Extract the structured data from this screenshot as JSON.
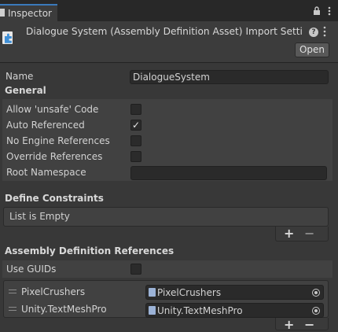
{
  "tab": {
    "label": "Inspector"
  },
  "header": {
    "title": "Dialogue System (Assembly Definition Asset) Import Settings",
    "help": "?",
    "open_label": "Open"
  },
  "name_field": {
    "label": "Name",
    "value": "DialogueSystem"
  },
  "general": {
    "title": "General",
    "allow_unsafe": {
      "label": "Allow 'unsafe' Code",
      "checked": false
    },
    "auto_referenced": {
      "label": "Auto Referenced",
      "checked": true,
      "mark": "✓"
    },
    "no_engine_refs": {
      "label": "No Engine References",
      "checked": false
    },
    "override_refs": {
      "label": "Override References",
      "checked": false
    },
    "root_namespace": {
      "label": "Root Namespace",
      "value": ""
    }
  },
  "define_constraints": {
    "title": "Define Constraints",
    "empty_text": "List is Empty",
    "add_label": "+",
    "remove_label": "−"
  },
  "assembly_refs": {
    "title": "Assembly Definition References",
    "use_guids": {
      "label": "Use GUIDs",
      "checked": false
    },
    "items": [
      {
        "label": "PixelCrushers",
        "value": "PixelCrushers"
      },
      {
        "label": "Unity.TextMeshPro",
        "value": "Unity.TextMeshPro"
      }
    ],
    "add_label": "+",
    "remove_label": "−"
  },
  "colors": {
    "background": "#383838",
    "field": "#2a2a2a",
    "tab_accent": "#3a79bb",
    "file_icon": "#9bb2d6"
  }
}
